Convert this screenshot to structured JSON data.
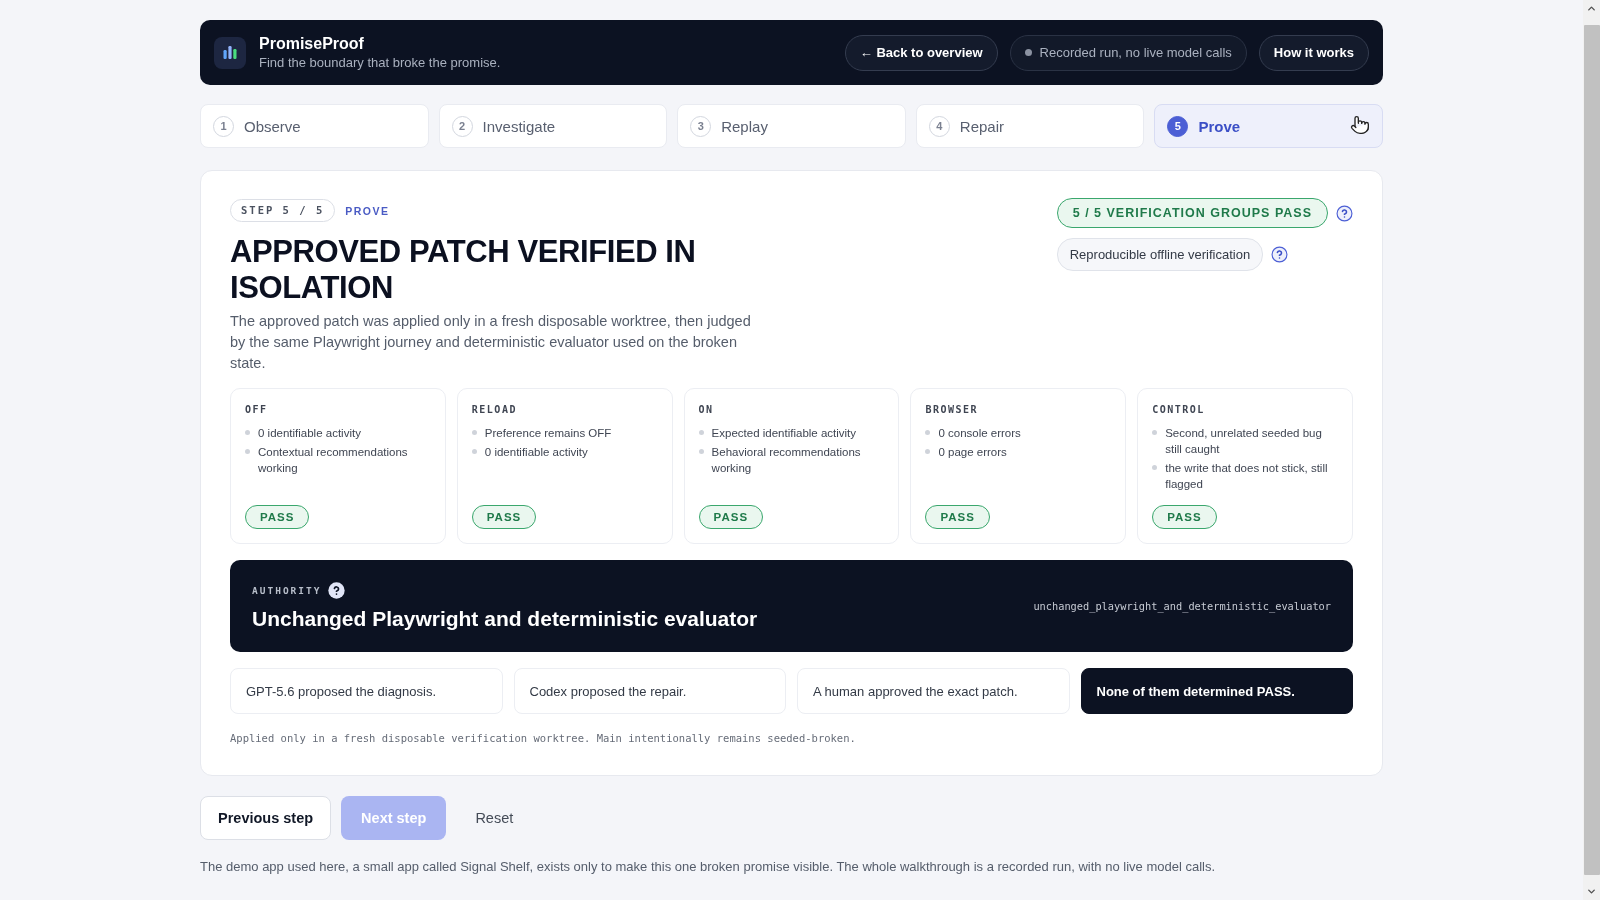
{
  "header": {
    "title": "PromiseProof",
    "subtitle": "Find the boundary that broke the promise.",
    "actions": [
      {
        "kind": "button",
        "label": "← Back to overview"
      },
      {
        "kind": "status",
        "label": "Recorded run, no live model calls"
      },
      {
        "kind": "button",
        "label": "How it works"
      }
    ]
  },
  "steps": [
    {
      "number": "1",
      "label": "Observe",
      "selected": false
    },
    {
      "number": "2",
      "label": "Investigate",
      "selected": false
    },
    {
      "number": "3",
      "label": "Replay",
      "selected": false
    },
    {
      "number": "4",
      "label": "Repair",
      "selected": false
    },
    {
      "number": "5",
      "label": "Prove",
      "selected": true
    }
  ],
  "step_panel": {
    "step_badge": "STEP 5 / 5",
    "step_name": "PROVE",
    "title": "APPROVED PATCH VERIFIED IN ISOLATION",
    "description": "The approved patch was applied only in a fresh disposable worktree, then judged by the same Playwright journey and deterministic evaluator used on the broken state.",
    "badges": [
      {
        "kind": "success",
        "label": "5 / 5 VERIFICATION GROUPS PASS"
      },
      {
        "kind": "neutral",
        "label": "Reproducible offline verification"
      }
    ],
    "checks": [
      {
        "name": "OFF",
        "items": [
          "0 identifiable activity",
          "Contextual recommendations working"
        ],
        "result": "PASS"
      },
      {
        "name": "RELOAD",
        "items": [
          "Preference remains OFF",
          "0 identifiable activity"
        ],
        "result": "PASS"
      },
      {
        "name": "ON",
        "items": [
          "Expected identifiable activity",
          "Behavioral recommendations working"
        ],
        "result": "PASS"
      },
      {
        "name": "BROWSER",
        "items": [
          "0 console errors",
          "0 page errors"
        ],
        "result": "PASS"
      },
      {
        "name": "CONTROL",
        "items": [
          "Second, unrelated seeded bug still caught",
          "the write that does not stick, still flagged"
        ],
        "result": "PASS"
      }
    ],
    "authority": {
      "label": "AUTHORITY",
      "title": "Unchanged Playwright and deterministic evaluator",
      "code": "unchanged_playwright_and_deterministic_evaluator"
    },
    "attributions": [
      {
        "text": "GPT-5.6 proposed the diagnosis.",
        "highlighted": false
      },
      {
        "text": "Codex proposed the repair.",
        "highlighted": false
      },
      {
        "text": "A human approved the exact patch.",
        "highlighted": false
      },
      {
        "text": "None of them determined PASS.",
        "highlighted": true
      }
    ],
    "note": "Applied only in a fresh disposable verification worktree. Main intentionally remains seeded-broken."
  },
  "navigation": [
    {
      "kind": "secondary",
      "label": "Previous step",
      "disabled": false
    },
    {
      "kind": "primary",
      "label": "Next step",
      "disabled": true
    },
    {
      "kind": "text",
      "label": "Reset",
      "disabled": false
    }
  ],
  "footer": "The demo app used here, a small app called Signal Shelf, exists only to make this one broken promise visible. The whole walkthrough is a recorded run, with no live model calls."
}
